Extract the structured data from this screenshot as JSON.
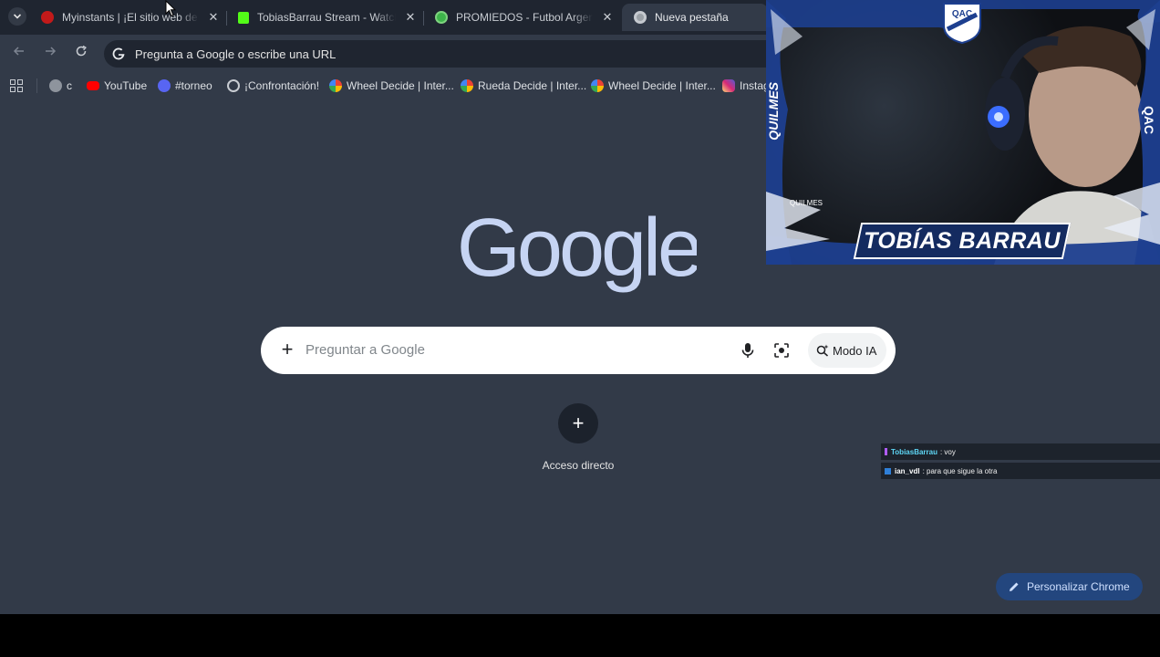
{
  "tabs": [
    {
      "title": "Myinstants | ¡El sitio web de botones de sonido!",
      "favicon": "myinstants-icon",
      "color": "#d91f1f",
      "active": false
    },
    {
      "title": "TobiasBarrau Stream - Watch Live on Kick",
      "favicon": "kick-icon",
      "color": "#53fc18",
      "active": false
    },
    {
      "title": "PROMIEDOS - Futbol Argentino",
      "favicon": "promiedos-icon",
      "color": "#3db54a",
      "active": false
    },
    {
      "title": "Nueva pestaña",
      "favicon": "chrome-icon",
      "color": "#9aa0a6",
      "active": true
    }
  ],
  "omnibox": {
    "placeholder": "Pregunta a Google o escribe una URL"
  },
  "bookmarks": [
    {
      "label": "c",
      "icon": "globe-icon"
    },
    {
      "label": "YouTube",
      "icon": "youtube-icon"
    },
    {
      "label": "#torneo",
      "icon": "discord-icon"
    },
    {
      "label": "¡Confrontación!",
      "icon": "site-icon"
    },
    {
      "label": "Wheel Decide | Inter...",
      "icon": "wheel-icon"
    },
    {
      "label": "Rueda Decide | Inter...",
      "icon": "wheel-icon"
    },
    {
      "label": "Wheel Decide | Inter...",
      "icon": "wheel-icon"
    },
    {
      "label": "Instag",
      "icon": "instagram-icon"
    }
  ],
  "logo": {
    "text": "Google"
  },
  "search": {
    "placeholder": "Preguntar a Google",
    "ai_mode_label": "Modo IA"
  },
  "shortcut": {
    "label": "Acceso directo"
  },
  "customize": {
    "label": "Personalizar Chrome"
  },
  "webcam": {
    "name": "TOBÍAS BARRAU",
    "side_left": "QUILMES",
    "side_right": "QAC",
    "crest": "QAC",
    "small_label": "QUILMES"
  },
  "chat": [
    {
      "user": "TobiasBarrau",
      "message": ": voy",
      "user_color": "#5ed6f5"
    },
    {
      "user": "ian_vdl",
      "message": ": para que sigue la otra",
      "user_color": "#ffffff"
    }
  ],
  "colors": {
    "page_bg": "#323a48",
    "tabstrip_bg": "#1f2530",
    "customize_bg": "#23467e"
  }
}
